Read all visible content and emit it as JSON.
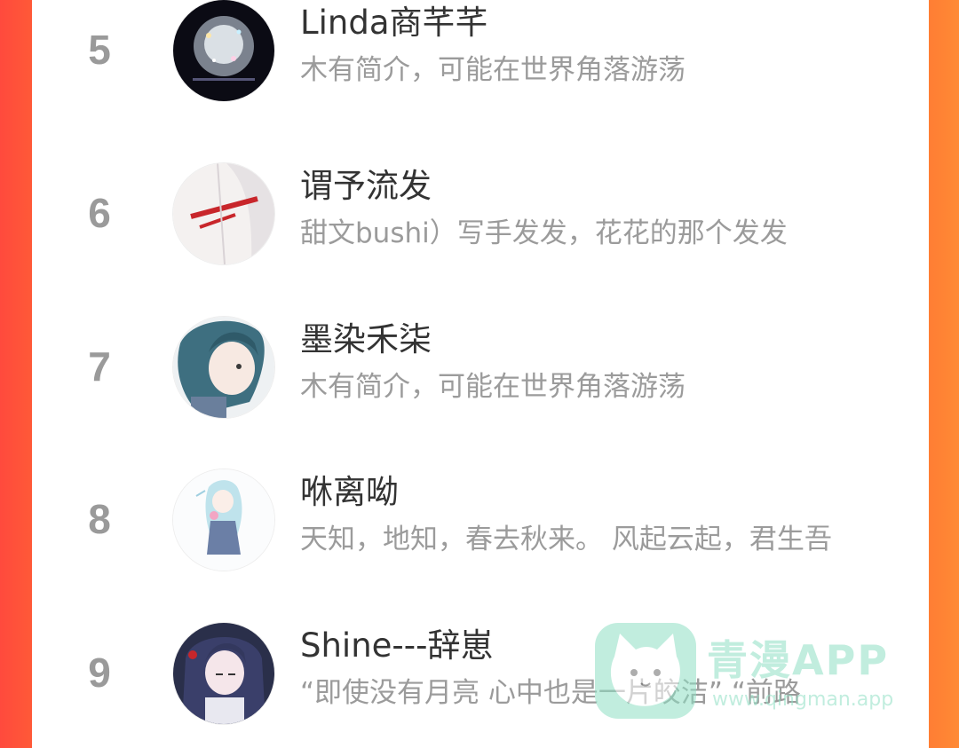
{
  "ranking": {
    "items": [
      {
        "rank": "5",
        "name": "Linda商芊芊",
        "intro": "木有简介，可能在世界角落游荡"
      },
      {
        "rank": "6",
        "name": "谓予流发",
        "intro": "甜文bushi）写手发发，花花的那个发发"
      },
      {
        "rank": "7",
        "name": "墨染禾柒",
        "intro": "木有简介，可能在世界角落游荡"
      },
      {
        "rank": "8",
        "name": "咻离呦",
        "intro": "天知，地知，春去秋来。 风起云起，君生吾"
      },
      {
        "rank": "9",
        "name": "Shine---辞崽",
        "intro": "“即使没有月亮 心中也是一片皎洁”  “前路"
      }
    ]
  },
  "watermark": {
    "title": "青漫APP",
    "url": "www.qingman.app"
  },
  "colors": {
    "background_left": "#ff4a3d",
    "background_right": "#ff8a35",
    "rank": "#9a9a9a",
    "name": "#333333",
    "intro": "#9b9b9b",
    "watermark": "#8fe0c4"
  }
}
